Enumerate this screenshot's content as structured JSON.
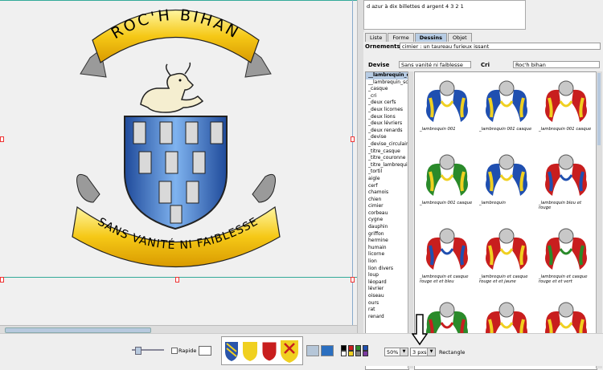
{
  "description_text": "d azur à dix billettes d argent 4 3 2 1",
  "crest": {
    "motto_top": "ROC'H BIHAN",
    "motto_bottom": "SANS VANITÉ NI FAIBLESSE"
  },
  "tabs": [
    {
      "label": "Liste"
    },
    {
      "label": "Forme"
    },
    {
      "label": "Dessins"
    },
    {
      "label": "Objet"
    }
  ],
  "ornements": {
    "label": "Ornements",
    "value": "cimier : un taureau furieux issant"
  },
  "devise": {
    "label": "Devise",
    "value": "Sans vanité ni faiblesse"
  },
  "cri": {
    "label": "Cri",
    "value": "Roc'h bihan"
  },
  "list_items": [
    "__lambrequin_c",
    "__lambrequin_sc",
    "_casque",
    "_cri",
    "_deux cerfs",
    "_deux licornes",
    "_deux lions",
    "_deux lévriers",
    "_deux renards",
    "_devise",
    "_devise_circulaire",
    "_titre_casque",
    "_titre_couronne",
    "_titre_lambrequin",
    "_tortil",
    "aigle",
    "cerf",
    "chamois",
    "chien",
    "cimier",
    "corbeau",
    "cygne",
    "dauphin",
    "griffon",
    "hermine",
    "humain",
    "licorne",
    "lion",
    "lion divers",
    "loup",
    "léopard",
    "lévrier",
    "oiseau",
    "ours",
    "rat",
    "renard"
  ],
  "gallery": [
    {
      "caption": "_lambrequin 001",
      "colors": [
        "#1f4fb0",
        "#f0d020"
      ]
    },
    {
      "caption": "_lambrequin 001 casque",
      "colors": [
        "#1f4fb0",
        "#f0d020"
      ]
    },
    {
      "caption": "_lambrequin 001 casque",
      "colors": [
        "#c81e1e",
        "#f0d020"
      ]
    },
    {
      "caption": "_lambrequin 001 casque",
      "colors": [
        "#2a8a2a",
        "#f0d020"
      ]
    },
    {
      "caption": "_lambrequin",
      "colors": [
        "#1f4fb0",
        "#f0d020"
      ]
    },
    {
      "caption": "_lambrequin bleu et rouge",
      "colors": [
        "#c81e1e",
        "#1f4fb0"
      ]
    },
    {
      "caption": "_lambrequin et casque rouge et et bleu",
      "colors": [
        "#c81e1e",
        "#1f4fb0"
      ]
    },
    {
      "caption": "_lambrequin et casque rouge et et jaune",
      "colors": [
        "#c81e1e",
        "#f0d020"
      ]
    },
    {
      "caption": "_lambrequin et casque rouge et et vert",
      "colors": [
        "#c81e1e",
        "#2a8a2a"
      ]
    },
    {
      "caption": "",
      "colors": [
        "#2a8a2a",
        "#c81e1e"
      ]
    },
    {
      "caption": "",
      "colors": [
        "#c81e1e",
        "#f0d020"
      ]
    },
    {
      "caption": "",
      "colors": [
        "#c81e1e",
        "#f0d020"
      ]
    }
  ],
  "bottom": {
    "rapide_label": "Rapide",
    "zoom": "50%",
    "stroke": "3 pxs",
    "shape": "Rectangle"
  },
  "palette": [
    "#000000",
    "#c81e1e",
    "#2a8a2a",
    "#1f4fb0",
    "#ffffff",
    "#f0d020",
    "#808080",
    "#7a3aa0"
  ]
}
